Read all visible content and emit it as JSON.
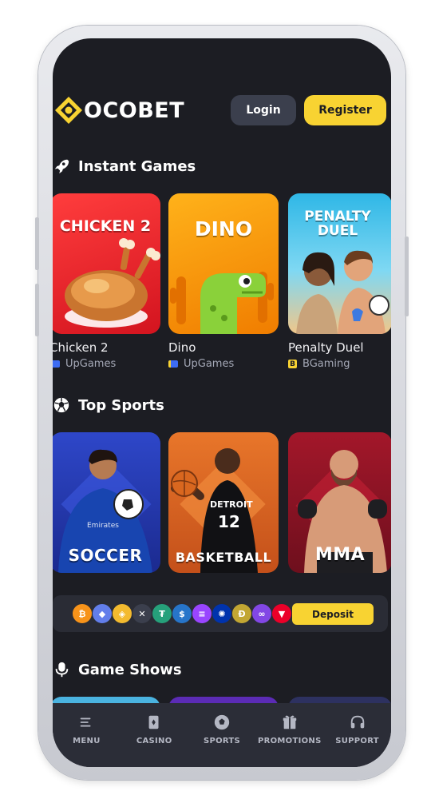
{
  "brand": {
    "name": "OCOBET",
    "logo_color": "#f8d332"
  },
  "header": {
    "login_label": "Login",
    "register_label": "Register"
  },
  "sections": {
    "instant_games": {
      "title": "Instant Games",
      "icon": "rocket-icon",
      "games": [
        {
          "card_title": "CHICKEN 2",
          "name": "Chicken 2",
          "provider": "UpGames"
        },
        {
          "card_title": "DINO",
          "name": "Dino",
          "provider": "UpGames"
        },
        {
          "card_title": "PENALTY DUEL",
          "name": "Penalty Duel",
          "provider": "BGaming",
          "provider_badge": "B"
        }
      ]
    },
    "top_sports": {
      "title": "Top Sports",
      "icon": "soccer-ball-icon",
      "sports": [
        {
          "label": "SOCCER",
          "jersey_text": "Emirates"
        },
        {
          "label": "BASKETBALL",
          "jersey_text": "DETROIT",
          "jersey_number": "12"
        },
        {
          "label": "MMA"
        }
      ]
    },
    "game_shows": {
      "title": "Game Shows",
      "icon": "microphone-icon"
    }
  },
  "deposit": {
    "button_label": "Deposit",
    "coins": [
      "bitcoin",
      "ethereum",
      "binance",
      "xrp",
      "tether",
      "usd-coin",
      "solana",
      "cardano",
      "dogecoin",
      "polygon",
      "tron"
    ],
    "coin_glyphs": [
      "₿",
      "◆",
      "◈",
      "✕",
      "₮",
      "$",
      "≡",
      "✺",
      "Ð",
      "∞",
      "▼"
    ]
  },
  "nav": {
    "items": [
      {
        "label": "MENU",
        "icon": "menu-icon"
      },
      {
        "label": "CASINO",
        "icon": "casino-card-icon"
      },
      {
        "label": "SPORTS",
        "icon": "soccer-ball-icon"
      },
      {
        "label": "PROMOTIONS",
        "icon": "gift-icon"
      },
      {
        "label": "SUPPORT",
        "icon": "headset-icon"
      }
    ]
  },
  "colors": {
    "background": "#1c1d23",
    "accent": "#f8d332",
    "nav_bg": "#2b2d37"
  }
}
